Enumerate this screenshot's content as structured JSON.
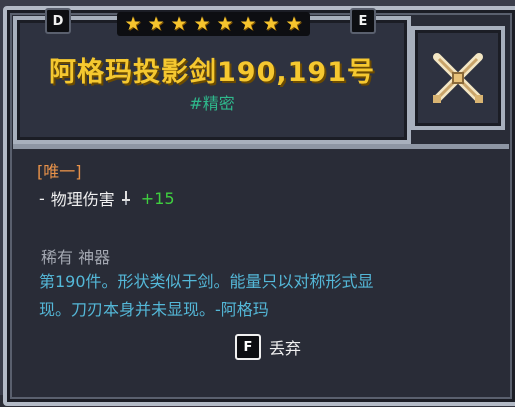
{
  "tabs": {
    "left_key": "D",
    "right_key": "E"
  },
  "stars": {
    "count": 8,
    "color": "#f6c42e"
  },
  "item": {
    "title": "阿格玛投影剑190,191号",
    "tag": "#精密",
    "icon": "crossed-swords-icon"
  },
  "details": {
    "unique_label": "[唯一]",
    "stat_prefix": "-",
    "stat_name": "物理伤害",
    "stat_icon": "sword-mini-icon",
    "stat_value": "+15",
    "rarity": "稀有 神器",
    "description_line1": "第190件。形状类似于剑。能量只以对称形式显",
    "description_line2": "现。刀刃本身并未显现。-阿格玛"
  },
  "actions": {
    "drop_key": "F",
    "drop_label": "丢弃"
  },
  "colors": {
    "title": "#f5c830",
    "tag": "#2fb88c",
    "unique": "#e8924a",
    "stat_value": "#3fd03f",
    "description": "#54b8d8",
    "rarity": "#a3a7b1"
  }
}
